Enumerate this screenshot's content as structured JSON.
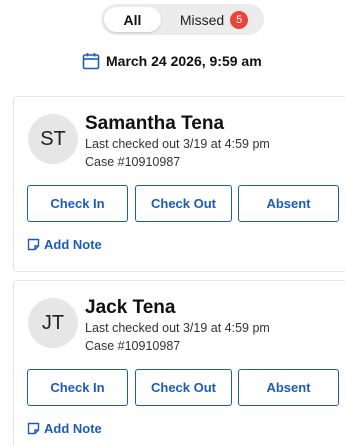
{
  "filter": {
    "all_label": "All",
    "missed_label": "Missed",
    "missed_count": "5"
  },
  "date": {
    "text": "March 24 2026, 9:59 am",
    "icon": "calendar-icon"
  },
  "colors": {
    "accent": "#1e5bb8",
    "badge": "#e8463a"
  },
  "records": [
    {
      "initials": "ST",
      "name": "Samantha Tena",
      "last_checked": "Last checked out 3/19 at 4:59 pm",
      "case": "Case #10910987",
      "check_in_label": "Check In",
      "check_out_label": "Check Out",
      "absent_label": "Absent",
      "note_label": "Add Note"
    },
    {
      "initials": "JT",
      "name": "Jack Tena",
      "last_checked": "Last checked out 3/19 at 4:59 pm",
      "case": "Case #10910987",
      "check_in_label": "Check In",
      "check_out_label": "Check Out",
      "absent_label": "Absent",
      "note_label": "Add Note"
    }
  ]
}
